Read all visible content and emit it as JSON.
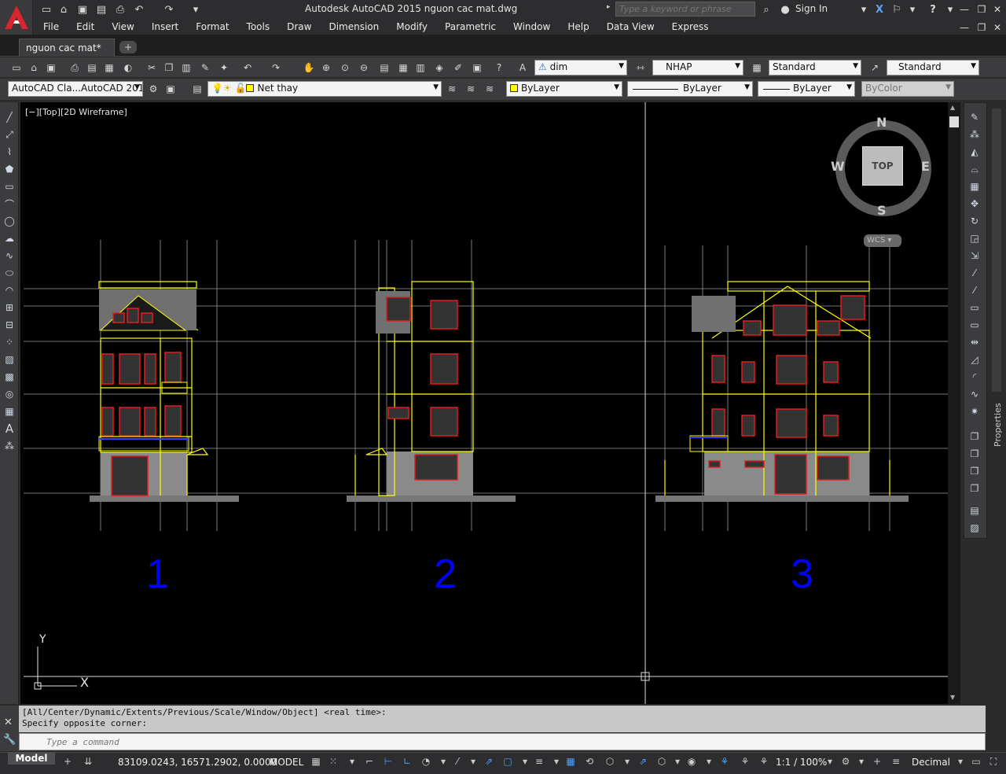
{
  "title": {
    "text": "Autodesk AutoCAD 2015    nguon cac mat.dwg",
    "search_placeholder": "Type a keyword or phrase",
    "sign_in": "Sign In"
  },
  "menu": [
    "File",
    "Edit",
    "View",
    "Insert",
    "Format",
    "Tools",
    "Draw",
    "Dimension",
    "Modify",
    "Parametric",
    "Window",
    "Help",
    "Data View",
    "Express"
  ],
  "tabs": {
    "active": "nguon cac mat*",
    "new_tab": "+"
  },
  "toolbar1": {
    "dim_style": "dim",
    "text_style": "NHAP",
    "table_style": "Standard",
    "multileader_style": "Standard"
  },
  "toolbar2": {
    "workspace": "AutoCAD Cla...AutoCAD 201",
    "layer": "Net thay",
    "color": "ByLayer",
    "linetype": "ByLayer",
    "lineweight": "ByLayer",
    "plotstyle": "ByColor",
    "colors": {
      "layer_swatch": "#ffff00",
      "color_swatch": "#ffff00"
    }
  },
  "viewport": {
    "label": "[−][Top][2D Wireframe]",
    "viewcube": {
      "top": "TOP",
      "n": "N",
      "s": "S",
      "e": "E",
      "w": "W",
      "wcs": "WCS"
    },
    "ucs": {
      "x": "X",
      "y": "Y"
    },
    "elevation_labels": [
      "1",
      "2",
      "3"
    ]
  },
  "command": {
    "history": [
      "[All/Center/Dynamic/Extents/Previous/Scale/Window/Object] <real time>:",
      "Specify opposite corner:"
    ],
    "placeholder": "Type a command"
  },
  "status": {
    "model_tab": "Model",
    "coords": "83109.0243, 16571.2902, 0.0000",
    "model": "MODEL",
    "scale": "1:1 / 100%",
    "units": "Decimal"
  },
  "palette": {
    "properties": "Properties"
  }
}
